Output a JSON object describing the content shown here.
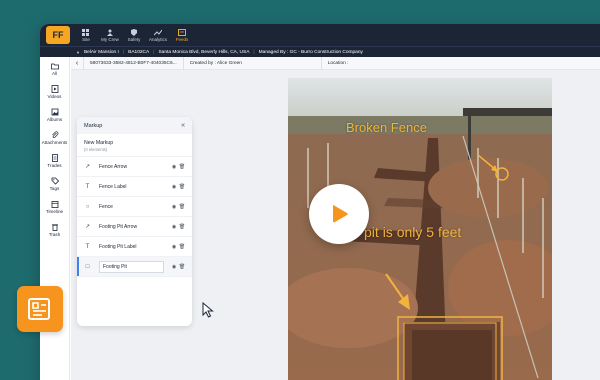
{
  "app": {
    "logo_label": "FF"
  },
  "topnav": {
    "items": [
      {
        "label": "Site",
        "icon": "grid-icon"
      },
      {
        "label": "My Crew",
        "icon": "crew-icon"
      },
      {
        "label": "Safety",
        "icon": "shield-icon"
      },
      {
        "label": "Analytics",
        "icon": "chart-icon"
      },
      {
        "label": "Feeds",
        "icon": "feeds-icon",
        "active": true
      }
    ]
  },
  "project": {
    "name": "BelAir Mansion I",
    "code": "BA102CA",
    "address": "Santa Monica Blvd, Beverly Hills, CA, USA",
    "managed_by": "Managed By : GC - Burro Construction Company"
  },
  "sidebar": {
    "items": [
      {
        "label": "All",
        "icon": "folder-icon"
      },
      {
        "label": "Videos",
        "icon": "video-icon"
      },
      {
        "label": "Albums",
        "icon": "album-icon"
      },
      {
        "label": "Attachments",
        "icon": "attachment-icon"
      },
      {
        "label": "Trades",
        "icon": "trades-icon"
      },
      {
        "label": "Tags",
        "icon": "tag-icon"
      },
      {
        "label": "Timeline",
        "icon": "calendar-icon"
      },
      {
        "label": "Trash",
        "icon": "trash-icon"
      }
    ]
  },
  "breadcrumb": {
    "id": "58073633-3582-4812-B0F7-404035C6...",
    "created_by": "Created by : Alice Green",
    "location": "Location :"
  },
  "markup_panel": {
    "title": "Markup",
    "new_markup_title": "New Markup",
    "new_markup_subtitle": "(0 elements)",
    "rows": [
      {
        "icon": "↗",
        "label": "Fence Arrow"
      },
      {
        "icon": "T",
        "label": "Fence Label"
      },
      {
        "icon": "○",
        "label": "Fence"
      },
      {
        "icon": "↗",
        "label": "Footing Pit Arrow"
      },
      {
        "icon": "T",
        "label": "Footing Pit Label"
      },
      {
        "icon": "□",
        "label": "Footing Pit",
        "editing": true
      }
    ]
  },
  "photo_annotations": {
    "fence_label": "Broken Fence",
    "pit_label": "The pit is only 5 feet"
  },
  "colors": {
    "annotation": "#f2b33d",
    "accent": "#f7941d",
    "nav_bg": "#1c2536"
  }
}
